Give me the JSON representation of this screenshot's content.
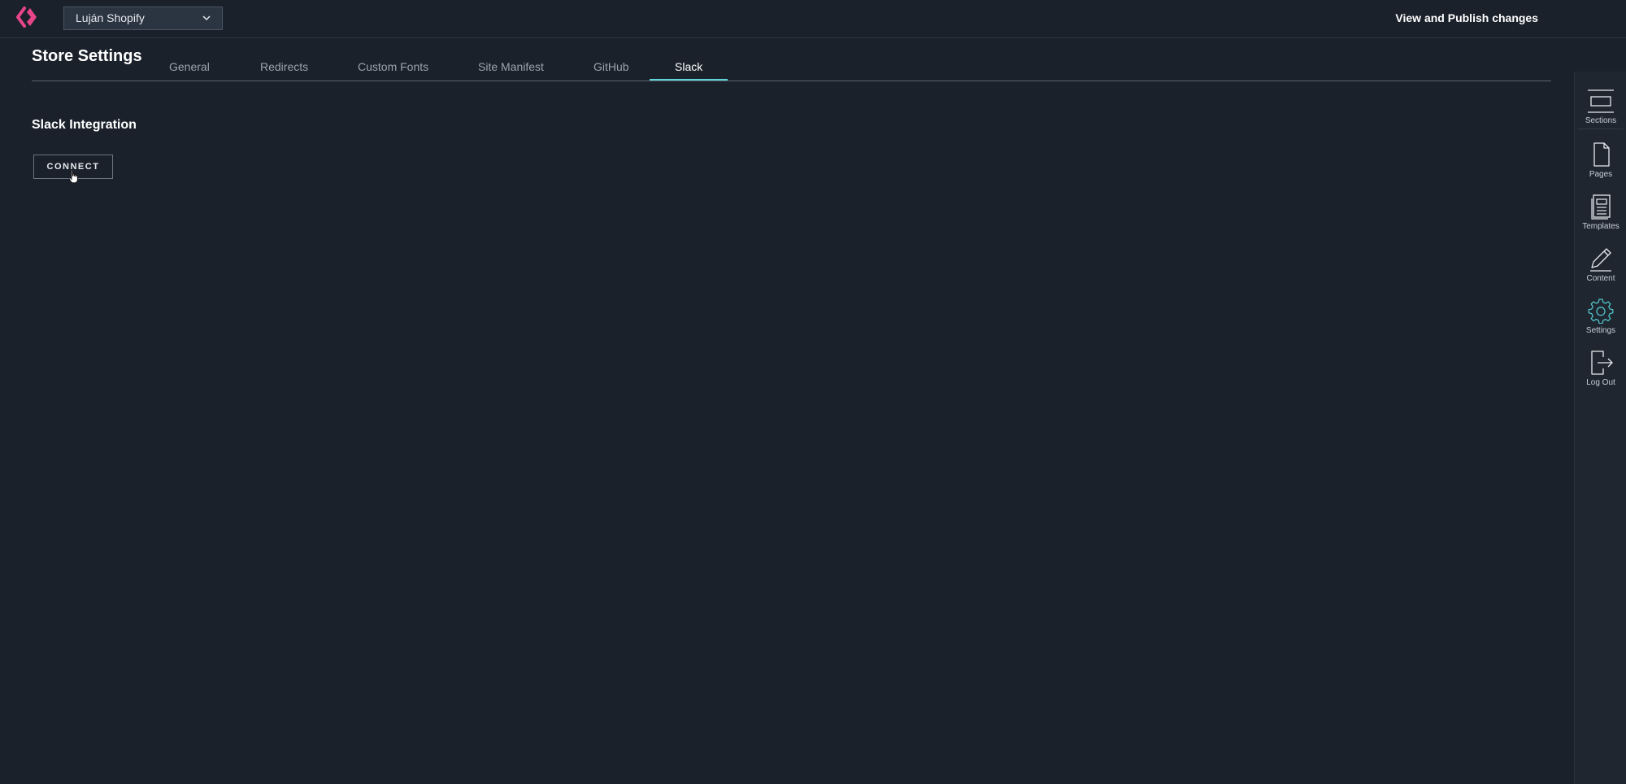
{
  "topbar": {
    "store_name": "Luján Shopify",
    "publish_label": "View and Publish changes"
  },
  "page": {
    "title": "Store Settings"
  },
  "tabs": [
    {
      "label": "General",
      "active": false
    },
    {
      "label": "Redirects",
      "active": false
    },
    {
      "label": "Custom Fonts",
      "active": false
    },
    {
      "label": "Site Manifest",
      "active": false
    },
    {
      "label": "GitHub",
      "active": false
    },
    {
      "label": "Slack",
      "active": true
    }
  ],
  "content": {
    "section_title": "Slack Integration",
    "connect_label": "CONNECT"
  },
  "rail": {
    "items": [
      {
        "label": "Sections",
        "icon": "sections-icon"
      },
      {
        "label": "Pages",
        "icon": "page-icon"
      },
      {
        "label": "Templates",
        "icon": "template-icon"
      },
      {
        "label": "Content",
        "icon": "pencil-icon"
      },
      {
        "label": "Settings",
        "icon": "gear-icon",
        "active": true
      },
      {
        "label": "Log Out",
        "icon": "logout-icon"
      }
    ]
  },
  "colors": {
    "background": "#1b212b",
    "accent": "#5fd4d8",
    "brand": "#e8458b",
    "settings_icon": "#4fc3c7"
  }
}
